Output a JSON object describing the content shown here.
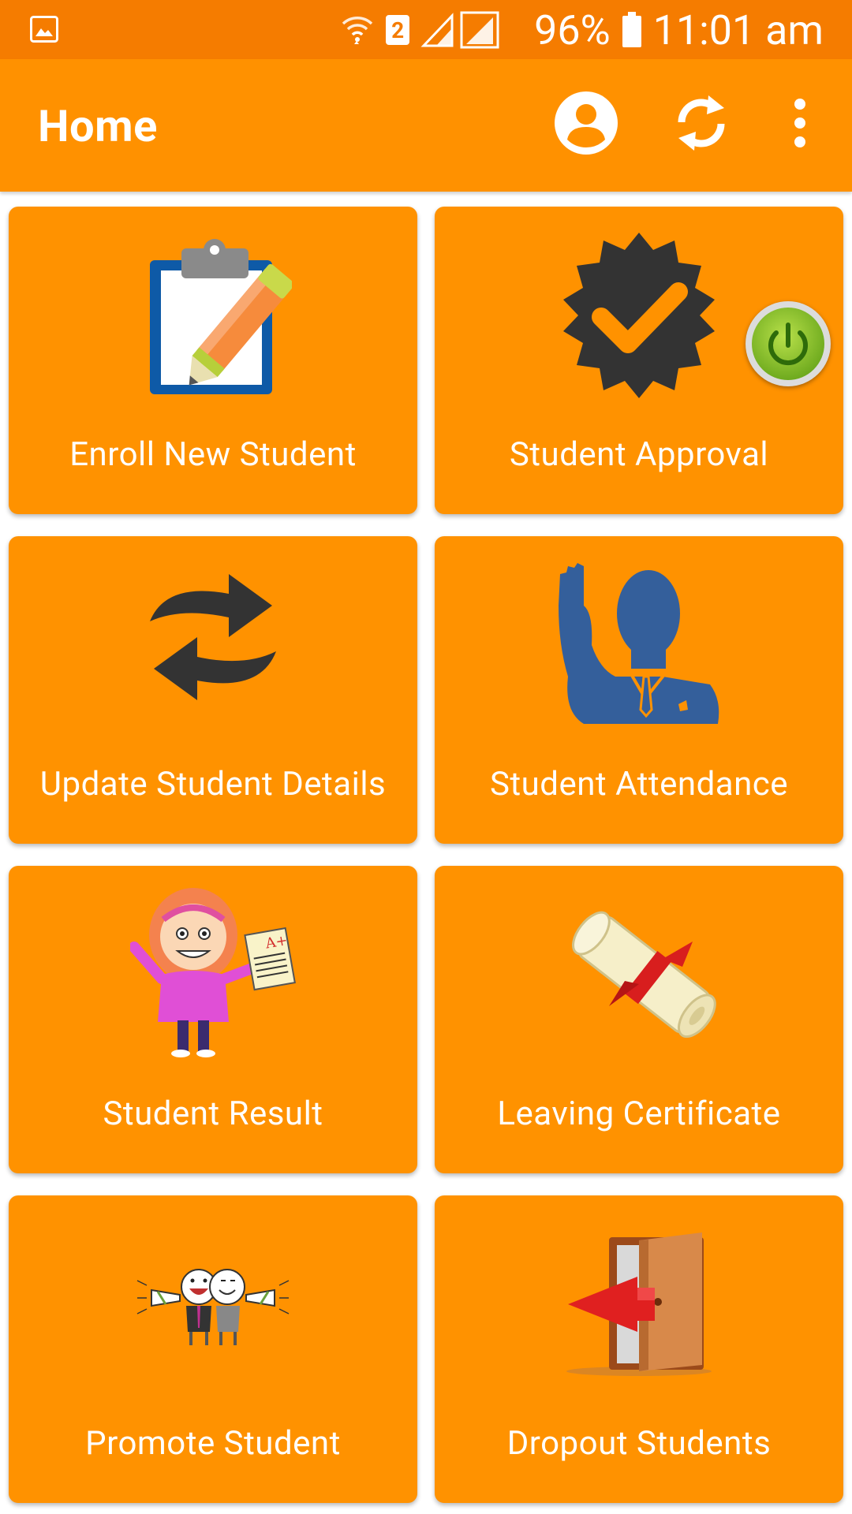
{
  "status_bar": {
    "sim_slot": "2",
    "battery_percent": "96%",
    "time": "11:01 am",
    "icons": [
      "gallery-icon",
      "wifi-icon",
      "signal-icon",
      "battery-icon"
    ]
  },
  "app_bar": {
    "title": "Home",
    "actions": [
      "account-icon",
      "sync-icon",
      "overflow-menu-icon"
    ]
  },
  "tiles": [
    {
      "label": "Enroll New Student",
      "icon": "clipboard-pencil-icon"
    },
    {
      "label": "Student Approval",
      "icon": "verified-badge-icon"
    },
    {
      "label": "Update Student Details",
      "icon": "refresh-arrows-icon"
    },
    {
      "label": "Student Attendance",
      "icon": "raised-hand-person-icon"
    },
    {
      "label": "Student Result",
      "icon": "student-report-card-icon"
    },
    {
      "label": "Leaving Certificate",
      "icon": "scroll-certificate-icon"
    },
    {
      "label": "Promote Student",
      "icon": "cheering-friends-icon"
    },
    {
      "label": "Dropout Students",
      "icon": "exit-door-icon"
    }
  ],
  "floating_button": {
    "icon": "power-icon"
  },
  "colors": {
    "status_bar": "#F57C00",
    "app_bar": "#FF9100",
    "tile": "#FF9200",
    "text": "#FFFFFF",
    "dark_icon": "#333333",
    "blue_icon": "#345F9B"
  }
}
